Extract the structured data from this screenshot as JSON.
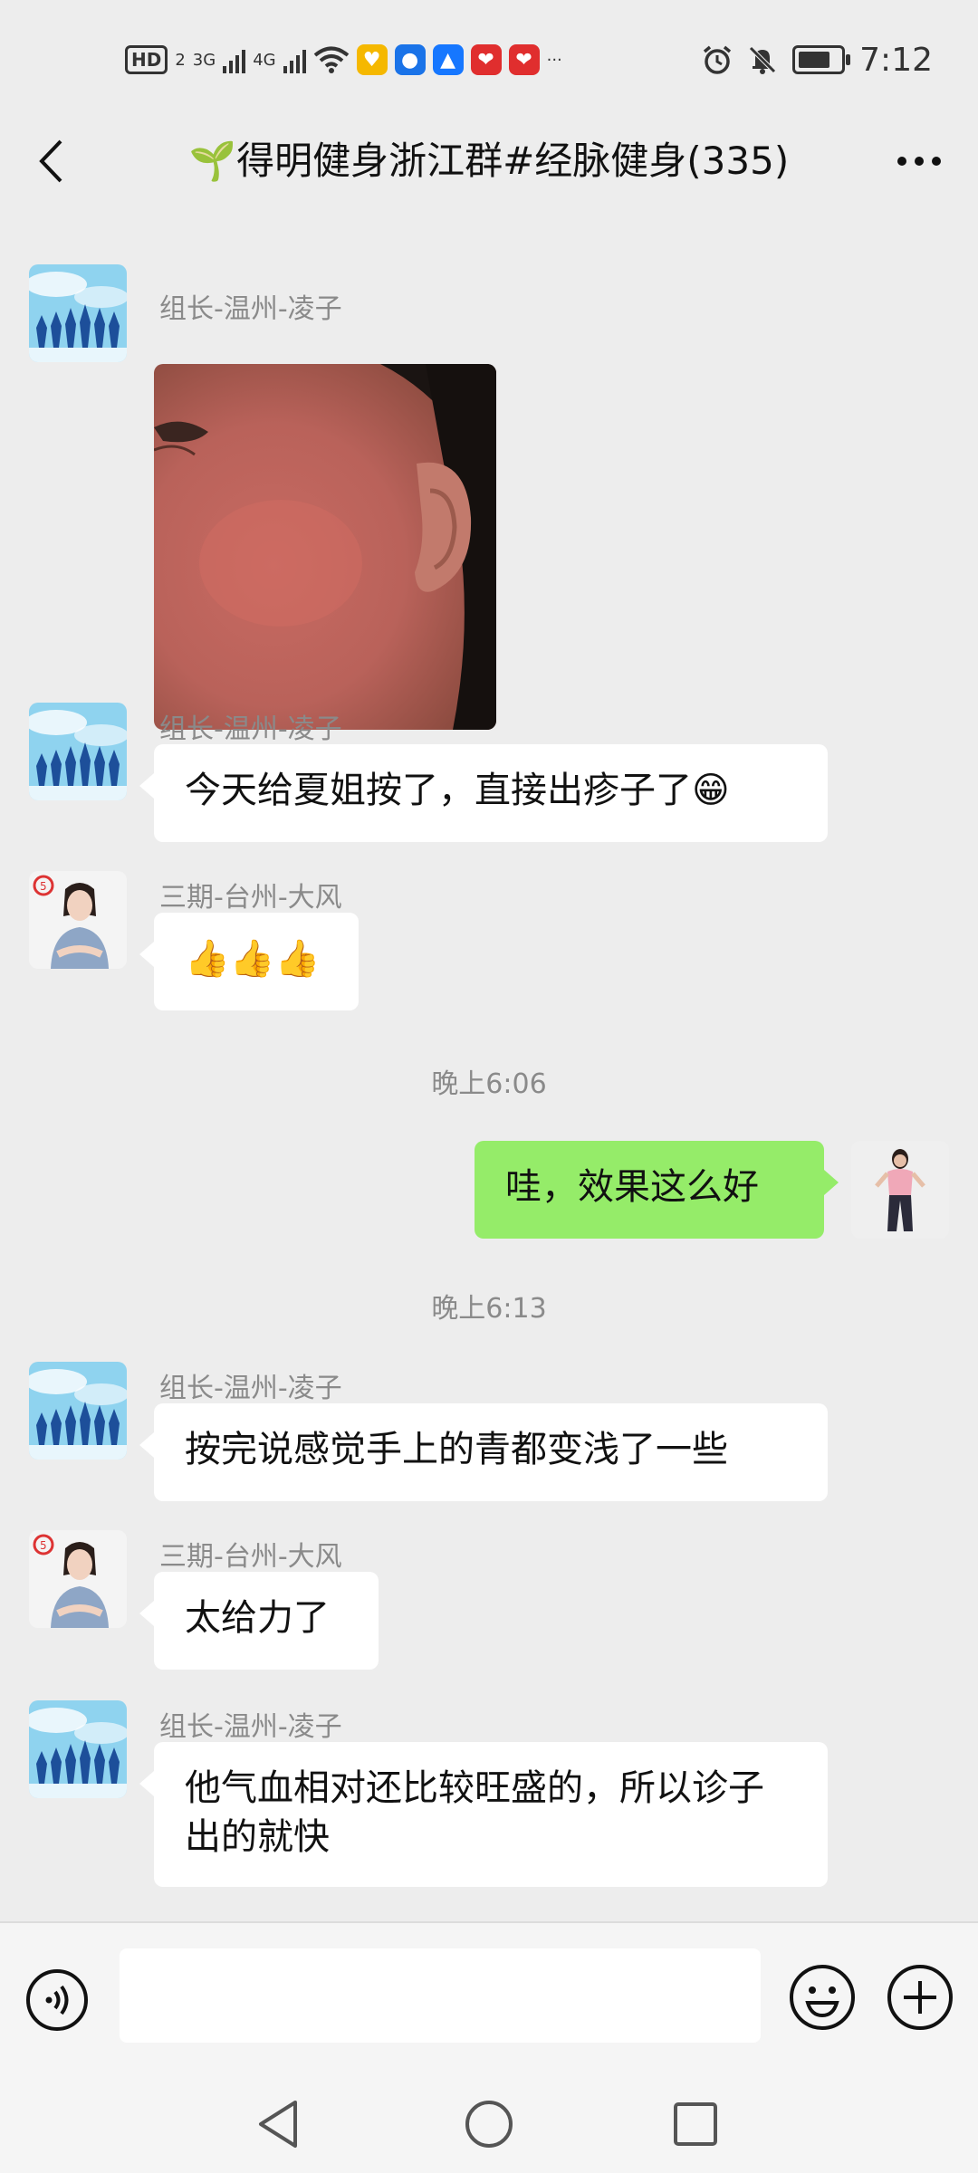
{
  "status_bar": {
    "hd": "HD",
    "sim": "2",
    "net1": "3G",
    "net2": "4G",
    "more": "···",
    "time": "7:12",
    "battery_level": 0.85
  },
  "header": {
    "title": "🌱得明健身浙江群#经脉健身(335)"
  },
  "messages": [
    {
      "sender": "组长-温州-凌子",
      "type": "image"
    },
    {
      "sender": "组长-温州-凌子",
      "text": "今天给夏姐按了，直接出疹子了😁"
    },
    {
      "sender": "三期-台州-大风",
      "text": "👍👍👍"
    },
    {
      "timestamp": "晚上6:06"
    },
    {
      "sender": "me",
      "text": "哇，效果这么好"
    },
    {
      "timestamp": "晚上6:13"
    },
    {
      "sender": "组长-温州-凌子",
      "text": "按完说感觉手上的青都变浅了一些"
    },
    {
      "sender": "三期-台州-大风",
      "text": "太给力了"
    },
    {
      "sender": "组长-温州-凌子",
      "text": "他气血相对还比较旺盛的，所以诊子出的就快"
    }
  ],
  "colors": {
    "background": "#ededed",
    "bubble_self": "#95ec69",
    "bubble_other": "#ffffff"
  }
}
